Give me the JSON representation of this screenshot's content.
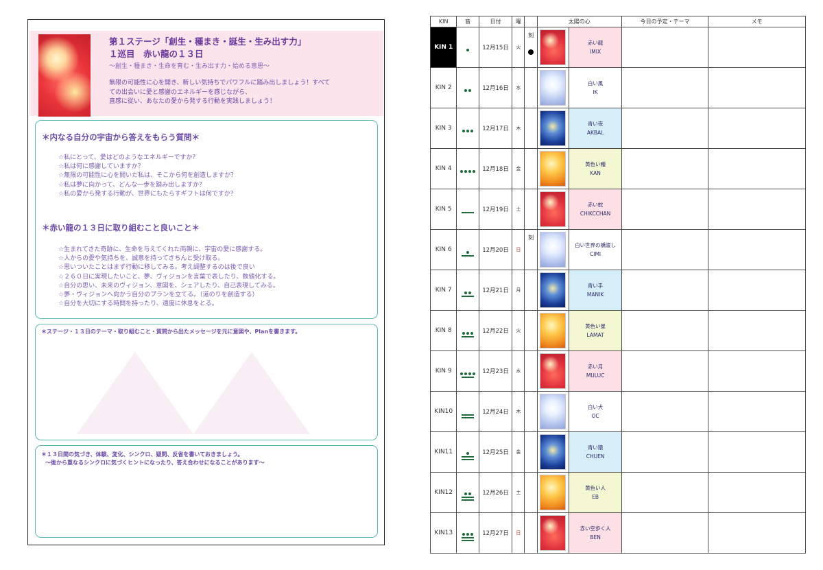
{
  "left_page": {
    "stage_title": "第１ステージ「創生・種まき・誕生・生み出す力」",
    "cycle_title": "１巡目　赤い龍の１３日",
    "subtitle": "〜創生・種まき・生命を育む・生み出す力・始める意思〜",
    "intro_lines": [
      "無限の可能性に心を開き、新しい気持ちでパワフルに踏み出しましょう！すべて",
      "ての出会いに愛と感謝のエネルギーを感じながら、",
      "直感に従い、あなたの愛から発する行動を実践しましょう！"
    ],
    "section1": {
      "heading": "＊内なる自分の宇宙から答えをもらう質問＊",
      "items": [
        "☆私にとって、愛はどのようなエネルギーですか？",
        "☆私は何に感謝していますか？",
        "☆無限の可能性に心を開いた私は、そこから何を創造しますか？",
        "☆私は夢に向かって、どんな一歩を踏み出しますか？",
        "☆私の愛から発する行動が、世界にもたらすギフトは何ですか？"
      ]
    },
    "section2": {
      "heading": "＊赤い龍の１３日に取り組むこと良いこと＊",
      "items": [
        "☆生まれてきた奇跡に、生命を与えてくれた両親に、宇宙の愛に感謝する。",
        "☆人からの愛や気持ちを、誠意を持ってきちんと受け取る。",
        "☆思いついたことはまず行動に移してみる。考え調整するのは後で良い",
        "☆２６０日に実現したいこと、夢、ヴィジョンを言葉で表したり、数値化する。",
        "☆自分の思い、未来のヴィジョン、意図を、シェアしたり、自己表現してみる。",
        "☆夢・ヴィジョンへ向かう自分のプランを立てる。（道のりを創造する）",
        "☆自分を大切にする時間を持ったり、適度に休息をとる。"
      ]
    },
    "box2_note": "＊ステージ・１３日のテーマ・取り組むこと・質問から出たメッセージを元に意図や、Planを書きます。",
    "box3_note_1": "＊１３日間の気づき、体験、変化、シンクロ、疑問、反省を書いておきましょう。",
    "box3_note_2": "〜後から重なるシンクロに気づくヒントになったり、答え合わせになることがあります〜"
  },
  "calendar": {
    "headers": {
      "kin": "KIN",
      "tone": "音",
      "date": "日付",
      "dow": "曜",
      "mark": "",
      "sun_heart": "太陽の心",
      "plan": "今日の予定・テーマ",
      "memo": "メモ"
    },
    "rows": [
      {
        "kin": "KIN 1",
        "tone": 1,
        "date": "12月15日",
        "dow": "火",
        "sun": false,
        "mark": "刻",
        "moon": true,
        "seal_ja": "赤い龍",
        "seal_en": "IMIX",
        "color": "#fde0e6",
        "art": "red"
      },
      {
        "kin": "KIN 2",
        "tone": 2,
        "date": "12月16日",
        "dow": "水",
        "sun": false,
        "mark": "",
        "moon": false,
        "seal_ja": "白い風",
        "seal_en": "IK",
        "color": "#ffffff",
        "art": "white"
      },
      {
        "kin": "KIN 3",
        "tone": 3,
        "date": "12月17日",
        "dow": "木",
        "sun": false,
        "mark": "",
        "moon": false,
        "seal_ja": "青い夜",
        "seal_en": "AKBAL",
        "color": "#d6eef8",
        "art": "blue"
      },
      {
        "kin": "KIN 4",
        "tone": 4,
        "date": "12月18日",
        "dow": "金",
        "sun": false,
        "mark": "",
        "moon": false,
        "seal_ja": "黄色い種",
        "seal_en": "KAN",
        "color": "#f3f7d2",
        "art": "yellow"
      },
      {
        "kin": "KIN 5",
        "tone": 5,
        "date": "12月19日",
        "dow": "土",
        "sun": false,
        "mark": "",
        "moon": false,
        "seal_ja": "赤い蛇",
        "seal_en": "CHIKCCHAN",
        "color": "#fde0e6",
        "art": "red"
      },
      {
        "kin": "KIN 6",
        "tone": 6,
        "date": "12月20日",
        "dow": "日",
        "sun": true,
        "mark": "刻",
        "moon": false,
        "seal_ja": "白い世界の橋渡し",
        "seal_en": "CIMI",
        "color": "#ffffff",
        "art": "white"
      },
      {
        "kin": "KIN 7",
        "tone": 7,
        "date": "12月21日",
        "dow": "月",
        "sun": false,
        "mark": "",
        "moon": false,
        "seal_ja": "青い手",
        "seal_en": "MANIK",
        "color": "#d6eef8",
        "art": "blue"
      },
      {
        "kin": "KIN 8",
        "tone": 8,
        "date": "12月22日",
        "dow": "火",
        "sun": false,
        "mark": "",
        "moon": false,
        "seal_ja": "黄色い星",
        "seal_en": "LAMAT",
        "color": "#f3f7d2",
        "art": "yellow"
      },
      {
        "kin": "KIN 9",
        "tone": 9,
        "date": "12月23日",
        "dow": "水",
        "sun": false,
        "mark": "",
        "moon": false,
        "seal_ja": "赤い月",
        "seal_en": "MULUC",
        "color": "#fde0e6",
        "art": "red"
      },
      {
        "kin": "KIN10",
        "tone": 10,
        "date": "12月24日",
        "dow": "木",
        "sun": false,
        "mark": "",
        "moon": false,
        "seal_ja": "白い犬",
        "seal_en": "OC",
        "color": "#ffffff",
        "art": "white"
      },
      {
        "kin": "KIN11",
        "tone": 11,
        "date": "12月25日",
        "dow": "金",
        "sun": false,
        "mark": "",
        "moon": false,
        "seal_ja": "青い猿",
        "seal_en": "CHUEN",
        "color": "#d6eef8",
        "art": "blue"
      },
      {
        "kin": "KIN12",
        "tone": 12,
        "date": "12月26日",
        "dow": "土",
        "sun": false,
        "mark": "",
        "moon": false,
        "seal_ja": "黄色い人",
        "seal_en": "EB",
        "color": "#f3f7d2",
        "art": "yellow"
      },
      {
        "kin": "KIN13",
        "tone": 13,
        "date": "12月27日",
        "dow": "日",
        "sun": true,
        "mark": "",
        "moon": false,
        "seal_ja": "赤い空歩く人",
        "seal_en": "BEN",
        "color": "#fde0e6",
        "art": "red"
      }
    ]
  }
}
